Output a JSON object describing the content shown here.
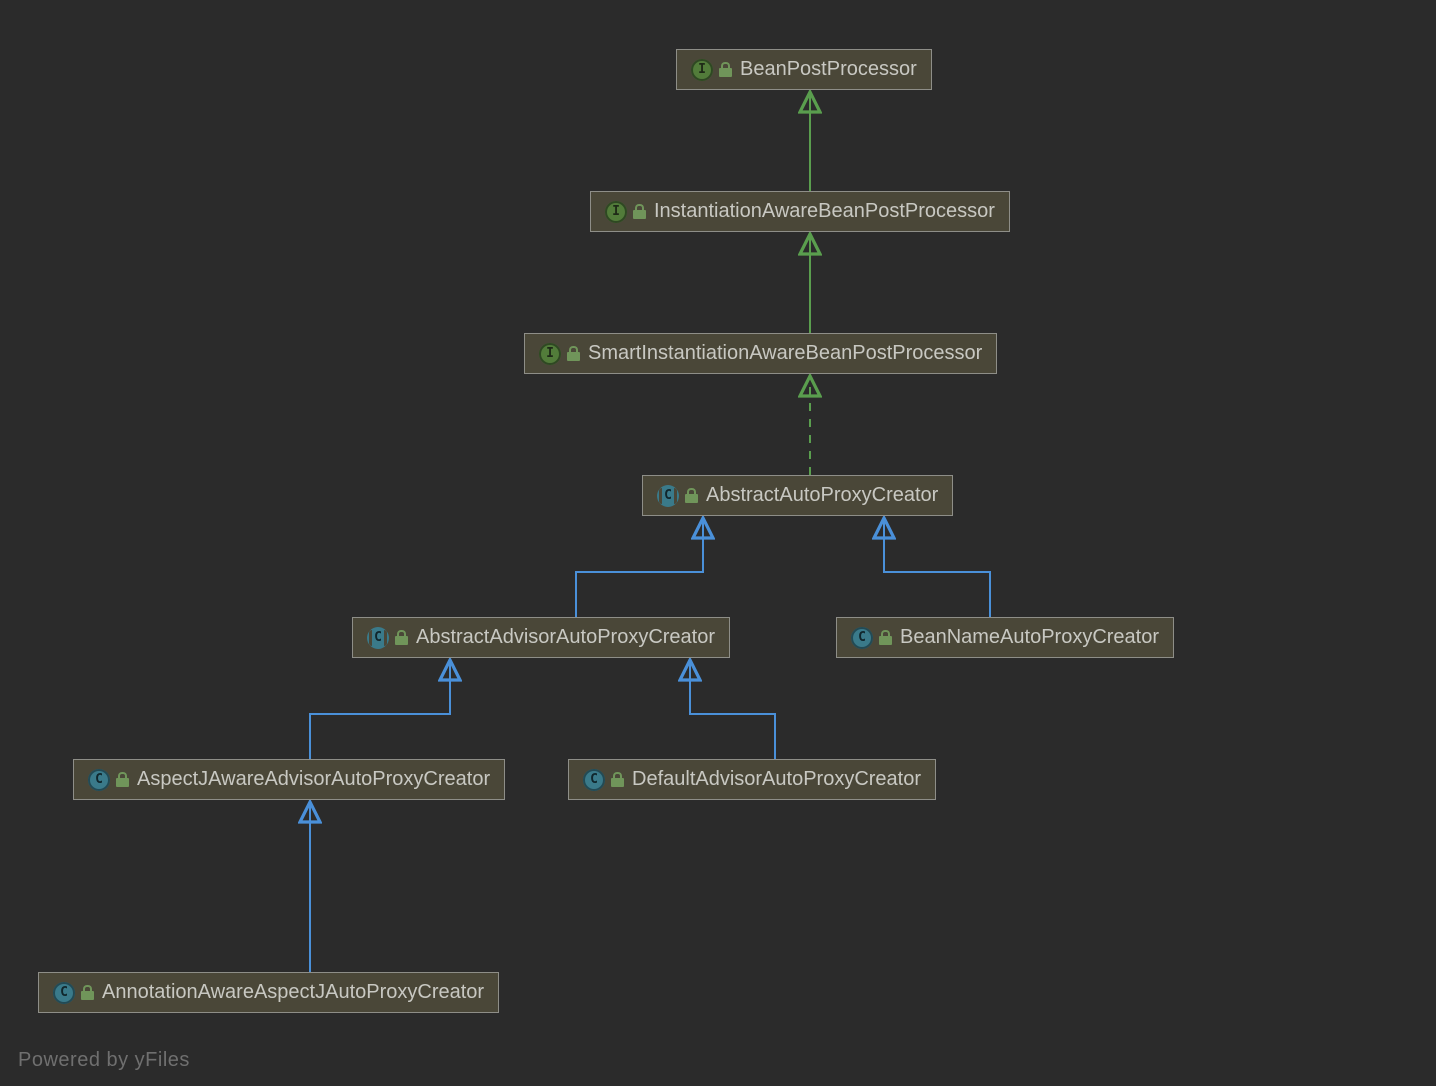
{
  "nodes": {
    "n0": {
      "kind": "interface",
      "label": "BeanPostProcessor"
    },
    "n1": {
      "kind": "interface",
      "label": "InstantiationAwareBeanPostProcessor"
    },
    "n2": {
      "kind": "interface",
      "label": "SmartInstantiationAwareBeanPostProcessor"
    },
    "n3": {
      "kind": "abstract",
      "label": "AbstractAutoProxyCreator"
    },
    "n4": {
      "kind": "abstract",
      "label": "AbstractAdvisorAutoProxyCreator"
    },
    "n5": {
      "kind": "class",
      "label": "BeanNameAutoProxyCreator"
    },
    "n6": {
      "kind": "class",
      "label": "AspectJAwareAdvisorAutoProxyCreator"
    },
    "n7": {
      "kind": "class",
      "label": "DefaultAdvisorAutoProxyCreator"
    },
    "n8": {
      "kind": "class",
      "label": "AnnotationAwareAspectJAutoProxyCreator"
    }
  },
  "edges": [
    {
      "from": "n1",
      "to": "n0",
      "style": "extends-interface"
    },
    {
      "from": "n2",
      "to": "n1",
      "style": "extends-interface"
    },
    {
      "from": "n3",
      "to": "n2",
      "style": "implements"
    },
    {
      "from": "n4",
      "to": "n3",
      "style": "extends-class"
    },
    {
      "from": "n5",
      "to": "n3",
      "style": "extends-class"
    },
    {
      "from": "n6",
      "to": "n4",
      "style": "extends-class"
    },
    {
      "from": "n7",
      "to": "n4",
      "style": "extends-class"
    },
    {
      "from": "n8",
      "to": "n6",
      "style": "extends-class"
    }
  ],
  "footer": "Powered by yFiles",
  "colors": {
    "extends_interface": "#5a9e4e",
    "implements": "#5a9e4e",
    "extends_class": "#4a90d9"
  }
}
